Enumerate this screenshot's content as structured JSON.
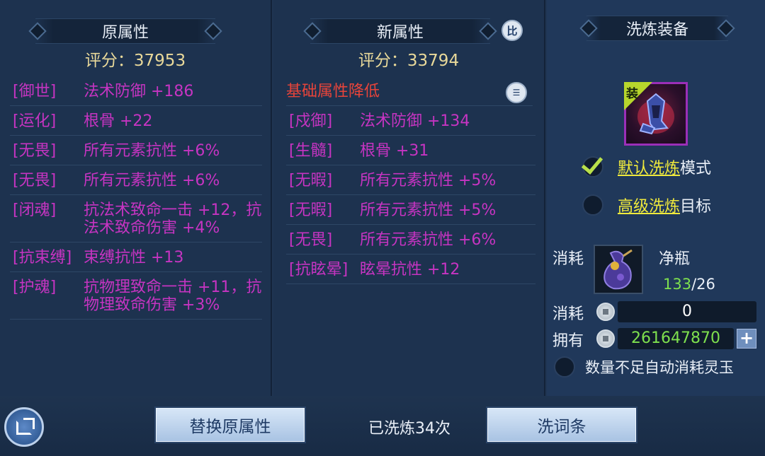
{
  "left": {
    "title": "原属性",
    "score": "评分：37953",
    "attrs": [
      {
        "tag": "[御世]",
        "value": "法术防御 +186"
      },
      {
        "tag": "[运化]",
        "value": "根骨 +22"
      },
      {
        "tag": "[无畏]",
        "value": "所有元素抗性 +6%"
      },
      {
        "tag": "[无畏]",
        "value": "所有元素抗性 +6%"
      },
      {
        "tag": "[闭魂]",
        "value": "抗法术致命一击 +12，抗法术致命伤害 +4%"
      },
      {
        "tag": "[抗束缚]",
        "value": "束缚抗性 +13"
      },
      {
        "tag": "[护魂]",
        "value": "抗物理致命一击 +11，抗物理致命伤害 +3%"
      }
    ]
  },
  "middle": {
    "title": "新属性",
    "compare_label": "比",
    "score": "评分：33794",
    "warning": "基础属性降低",
    "attrs": [
      {
        "tag": "[戍御]",
        "value": "法术防御 +134"
      },
      {
        "tag": "[生髓]",
        "value": "根骨 +31"
      },
      {
        "tag": "[无暇]",
        "value": "所有元素抗性 +5%"
      },
      {
        "tag": "[无暇]",
        "value": "所有元素抗性 +5%"
      },
      {
        "tag": "[无畏]",
        "value": "所有元素抗性 +6%"
      },
      {
        "tag": "[抗眩晕]",
        "value": "眩晕抗性 +12"
      }
    ]
  },
  "right": {
    "title": "洗炼装备",
    "equip_tag": "装",
    "mode_default": {
      "link": "默认洗炼",
      "suffix": "模式",
      "checked": true
    },
    "mode_advanced": {
      "link": "高级洗炼",
      "suffix": "目标",
      "checked": false
    },
    "cost_label": "消耗",
    "item_name": "净瓶",
    "item_have": "133",
    "item_need": "/26",
    "cost2_label": "消耗",
    "cost2_value": "0",
    "own_label": "拥有",
    "own_value": "261647870",
    "plus": "+",
    "auto_label": "数量不足自动消耗灵玉"
  },
  "bottom": {
    "replace_btn": "替换原属性",
    "count_text": "已洗炼34次",
    "wash_btn": "洗词条"
  },
  "colors": {
    "attr_purple": "#c634c2",
    "score_gold": "#e9d99a",
    "warn_red": "#e8443a",
    "link_yellow": "#f0ea3c",
    "green_value": "#7ee04e"
  }
}
